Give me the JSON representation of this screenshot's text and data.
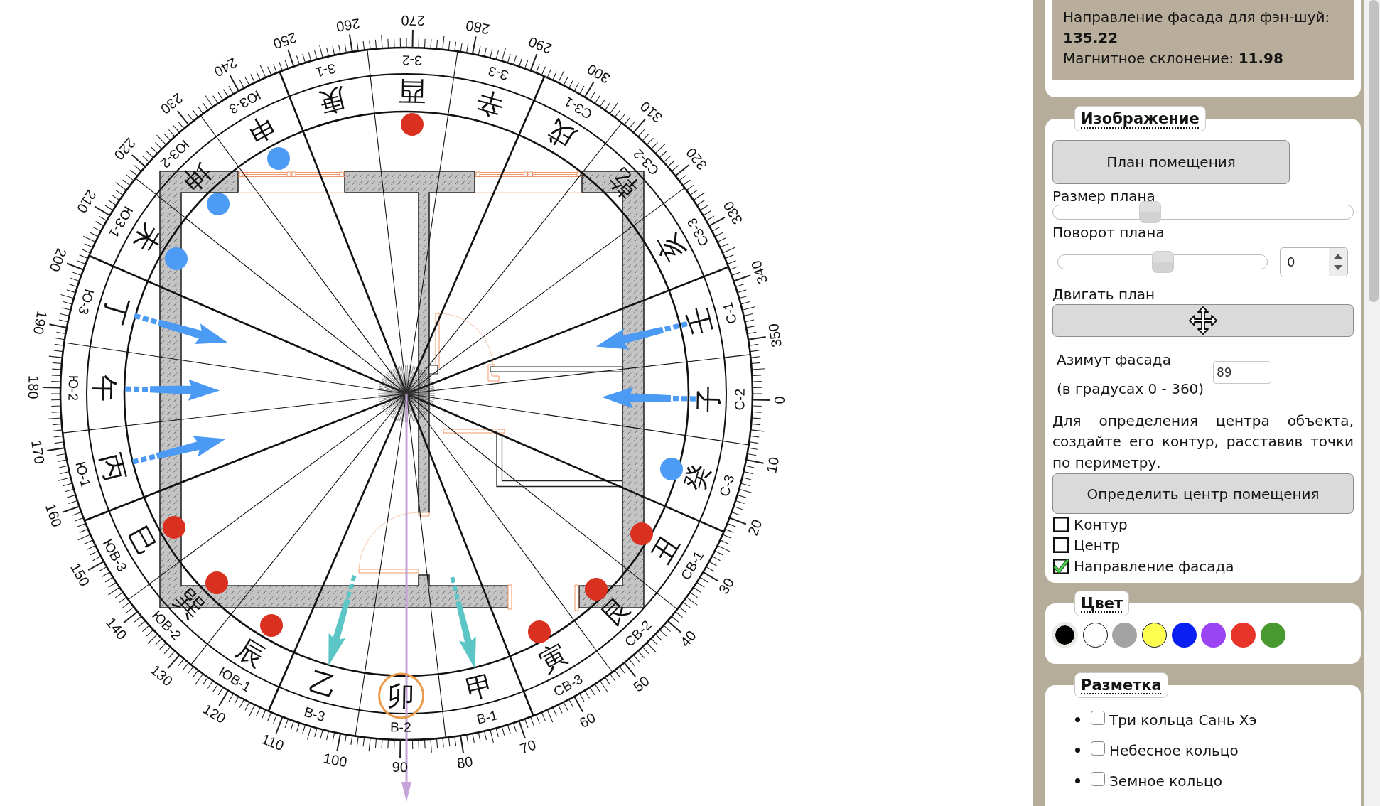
{
  "compass": {
    "degree_labels": [
      "0",
      "10",
      "20",
      "30",
      "40",
      "50",
      "60",
      "70",
      "80",
      "90",
      "100",
      "110",
      "120",
      "130",
      "140",
      "150",
      "160",
      "170",
      "180",
      "190",
      "200",
      "210",
      "220",
      "230",
      "240",
      "250",
      "260",
      "270",
      "280",
      "290",
      "300",
      "310",
      "320",
      "330",
      "340",
      "350"
    ],
    "mountains": [
      {
        "character": "子",
        "label": "С-2",
        "highlighted": false
      },
      {
        "character": "癸",
        "label": "С-3",
        "highlighted": false
      },
      {
        "character": "丑",
        "label": "СВ-1",
        "highlighted": false
      },
      {
        "character": "艮",
        "label": "СВ-2",
        "highlighted": false
      },
      {
        "character": "寅",
        "label": "СВ-3",
        "highlighted": false
      },
      {
        "character": "甲",
        "label": "В-1",
        "highlighted": false
      },
      {
        "character": "卯",
        "label": "В-2",
        "highlighted": true
      },
      {
        "character": "乙",
        "label": "В-3",
        "highlighted": false
      },
      {
        "character": "辰",
        "label": "ЮВ-1",
        "highlighted": false
      },
      {
        "character": "巽",
        "label": "ЮВ-2",
        "highlighted": false
      },
      {
        "character": "巳",
        "label": "ЮВ-3",
        "highlighted": false
      },
      {
        "character": "丙",
        "label": "Ю-1",
        "highlighted": false
      },
      {
        "character": "午",
        "label": "Ю-2",
        "highlighted": false
      },
      {
        "character": "丁",
        "label": "Ю-3",
        "highlighted": false
      },
      {
        "character": "未",
        "label": "ЮЗ-1",
        "highlighted": false
      },
      {
        "character": "坤",
        "label": "ЮЗ-2",
        "highlighted": false
      },
      {
        "character": "申",
        "label": "ЮЗ-3",
        "highlighted": false
      },
      {
        "character": "庚",
        "label": "З-1",
        "highlighted": false
      },
      {
        "character": "酉",
        "label": "З-2",
        "highlighted": false
      },
      {
        "character": "辛",
        "label": "З-3",
        "highlighted": false
      },
      {
        "character": "戌",
        "label": "СЗ-1",
        "highlighted": false
      },
      {
        "character": "乾",
        "label": "СЗ-2",
        "highlighted": false
      },
      {
        "character": "亥",
        "label": "СЗ-3",
        "highlighted": false
      },
      {
        "character": "壬",
        "label": "С-1",
        "highlighted": false
      }
    ],
    "markers": [
      {
        "color": "#d9301f"
      },
      {
        "color": "#4c9bf5"
      },
      {
        "color": "#4c9bf5"
      },
      {
        "color": "#4c9bf5"
      },
      {
        "color": "#4c9bf5"
      },
      {
        "color": "#d9301f"
      },
      {
        "color": "#d9301f"
      },
      {
        "color": "#d9301f"
      },
      {
        "color": "#d9301f"
      },
      {
        "color": "#d9301f"
      },
      {
        "color": "#d9301f"
      }
    ],
    "arrows": [
      {
        "color": "#4b9af4"
      },
      {
        "color": "#4b9af4"
      },
      {
        "color": "#4b9af4"
      },
      {
        "color": "#4b9af4"
      },
      {
        "color": "#4b9af4"
      },
      {
        "color": "#5cc6c6"
      },
      {
        "color": "#5cc6c6"
      }
    ]
  },
  "sidebar": {
    "info": {
      "facade_direction": "Направление фасада для фэн-шуй: **135.22**",
      "declination": "Магнитное склонение: **11.98**"
    },
    "image_section": {
      "legend": "Изображение",
      "plan_button": "План помещения",
      "size_label": "Размер плана",
      "size_slider": {
        "level": 0.31
      },
      "rotation_label": "Поворот плана",
      "rotation_slider": {
        "level": 0.5
      },
      "rotation_value": "0",
      "move_label": "Двигать план",
      "azimuth_label": "Азимут фасада",
      "azimuth_hint": "(в градусах 0 - 360)",
      "azimuth_value": "89",
      "center_help": "Для определения центра объекта, создайте его контур, расставив точки по периметру.",
      "center_button": "Определить центр помещения",
      "checkboxes": [
        {
          "kind": "contour",
          "label": "Контур",
          "checked": false
        },
        {
          "kind": "center",
          "label": "Центр",
          "checked": false
        },
        {
          "kind": "facade",
          "label": "Направление фасада",
          "checked": true
        }
      ]
    },
    "color_section": {
      "legend": "Цвет",
      "swatches": [
        {
          "color": "#000000",
          "selected": true
        },
        {
          "color": "#ffffff",
          "selected": false
        },
        {
          "color": "#a3a3a3",
          "selected": false
        },
        {
          "color": "#ffff50",
          "selected": false
        },
        {
          "color": "#0a1ff2",
          "selected": false
        },
        {
          "color": "#9a44f4",
          "selected": false
        },
        {
          "color": "#e8352a",
          "selected": false
        },
        {
          "color": "#489a30",
          "selected": false
        }
      ]
    },
    "markup_section": {
      "legend": "Разметка",
      "items": [
        {
          "label": "Три кольца Сань Хэ",
          "checked": false
        },
        {
          "label": "Небесное кольцо",
          "checked": false
        },
        {
          "label": "Земное кольцо",
          "checked": false
        }
      ]
    }
  }
}
